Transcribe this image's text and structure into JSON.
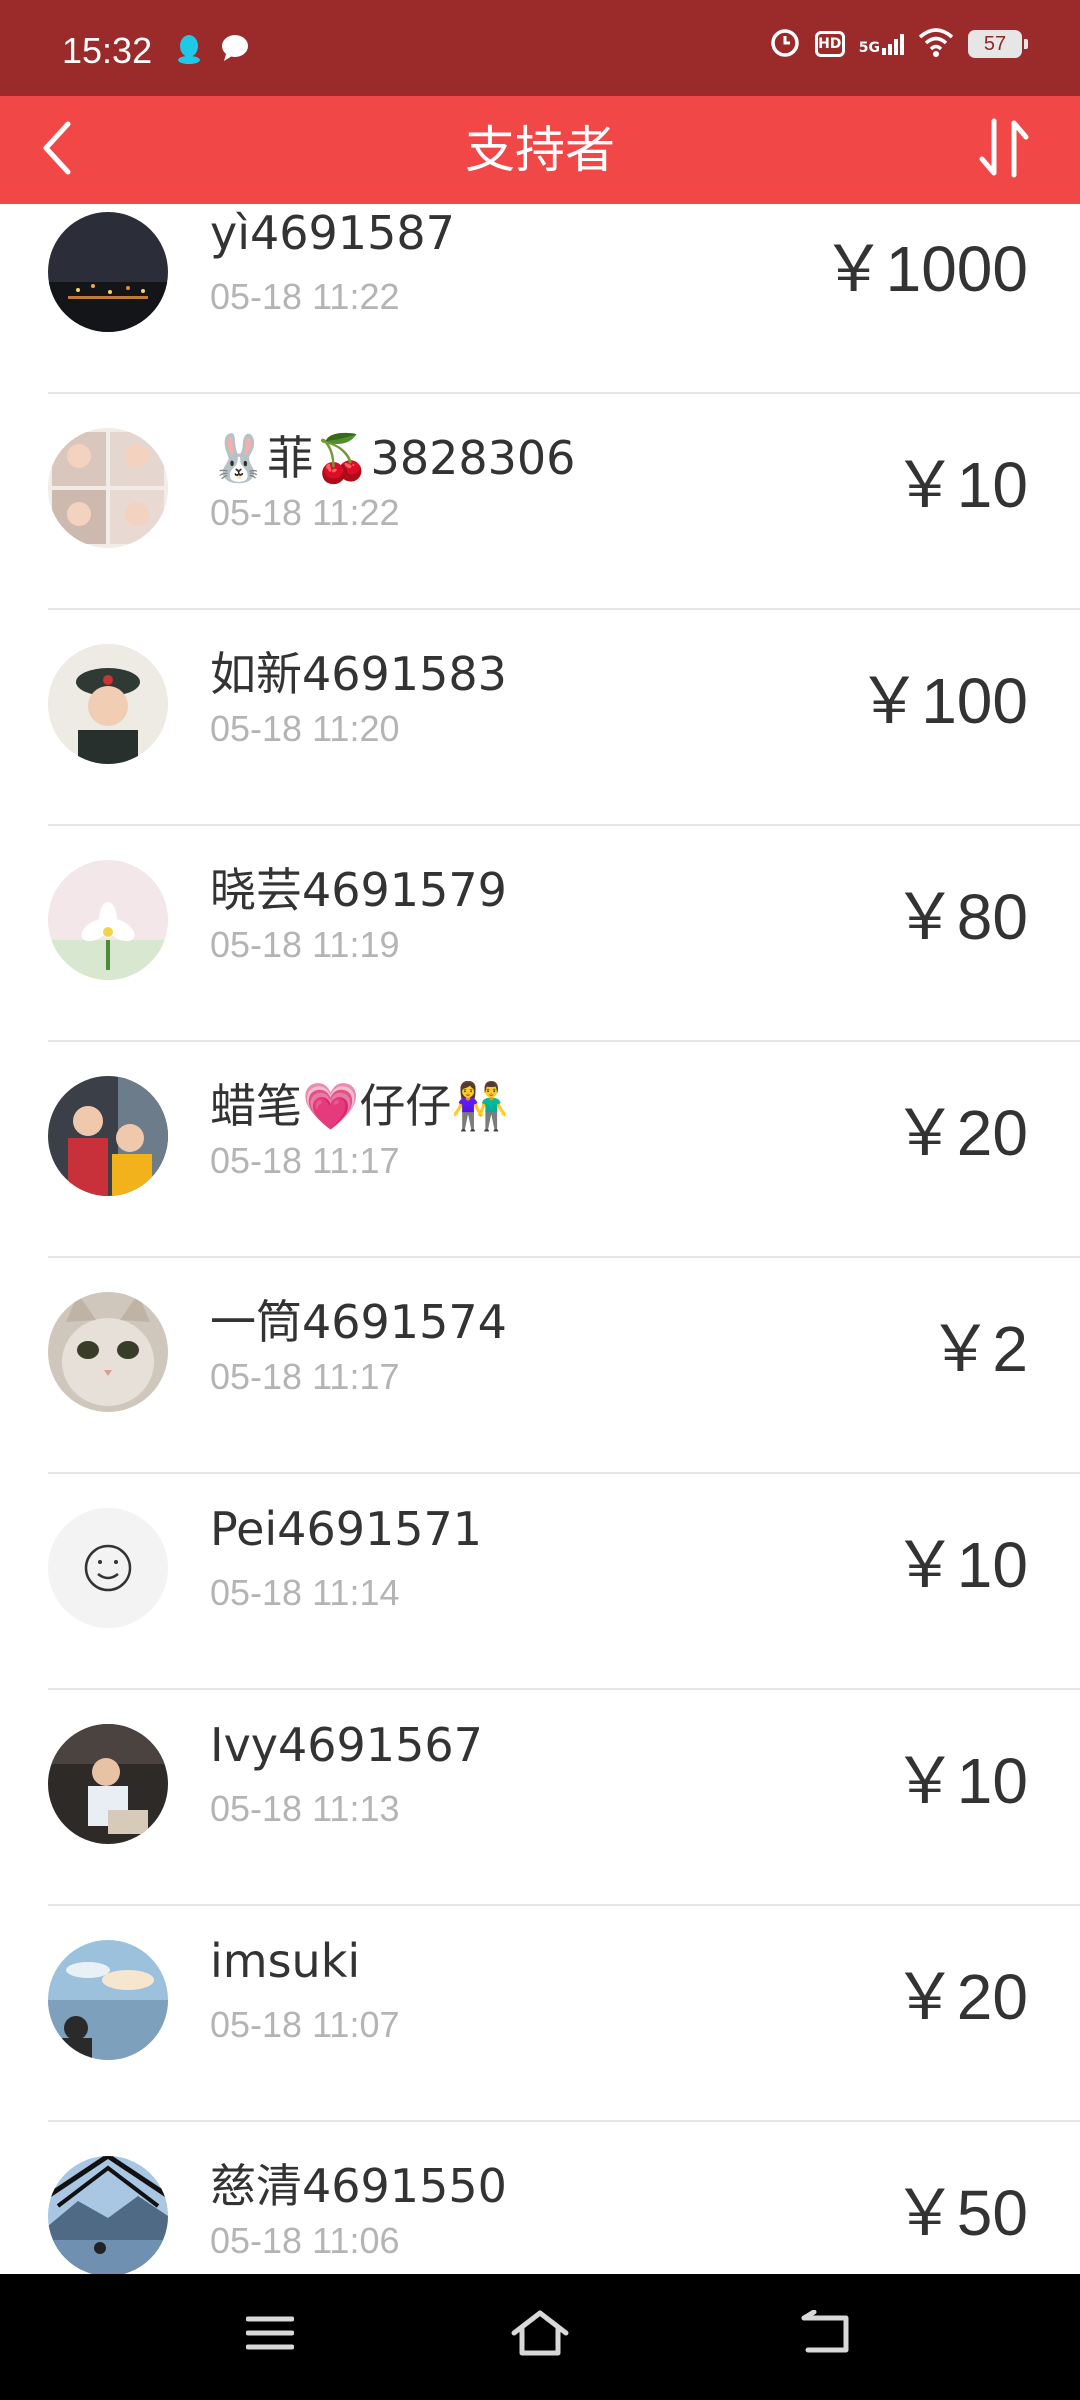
{
  "status_bar": {
    "time": "15:32",
    "network": "5G",
    "hd": "HD",
    "battery": "57",
    "icons": [
      "qq-penguin-icon",
      "chat-bubble-icon",
      "alarm-icon",
      "hd-icon",
      "signal-5g-icon",
      "wifi-icon",
      "battery-icon"
    ]
  },
  "header": {
    "title": "支持者",
    "back_icon": "chevron-left-icon",
    "sort_icon": "sort-arrows-icon",
    "color": "#f24747"
  },
  "supporters": [
    {
      "name": "yì4691587",
      "time": "05-18 11:22",
      "amount": "￥1000"
    },
    {
      "name": "🐰菲🍒3828306",
      "time": "05-18 11:22",
      "amount": "￥10"
    },
    {
      "name": "如新4691583",
      "time": "05-18 11:20",
      "amount": "￥100"
    },
    {
      "name": "晓芸4691579",
      "time": "05-18 11:19",
      "amount": "￥80"
    },
    {
      "name": "蜡笔💗仔仔👫",
      "time": "05-18 11:17",
      "amount": "￥20"
    },
    {
      "name": "一筒4691574",
      "time": "05-18 11:17",
      "amount": "￥2"
    },
    {
      "name": "Pei4691571",
      "time": "05-18 11:14",
      "amount": "￥10"
    },
    {
      "name": "Ivy4691567",
      "time": "05-18 11:13",
      "amount": "￥10"
    },
    {
      "name": "imsuki",
      "time": "05-18 11:07",
      "amount": "￥20"
    },
    {
      "name": "慈清4691550",
      "time": "05-18 11:06",
      "amount": "￥50"
    }
  ],
  "nav_bar": {
    "icons": [
      "menu-icon",
      "home-icon",
      "back-icon"
    ]
  }
}
